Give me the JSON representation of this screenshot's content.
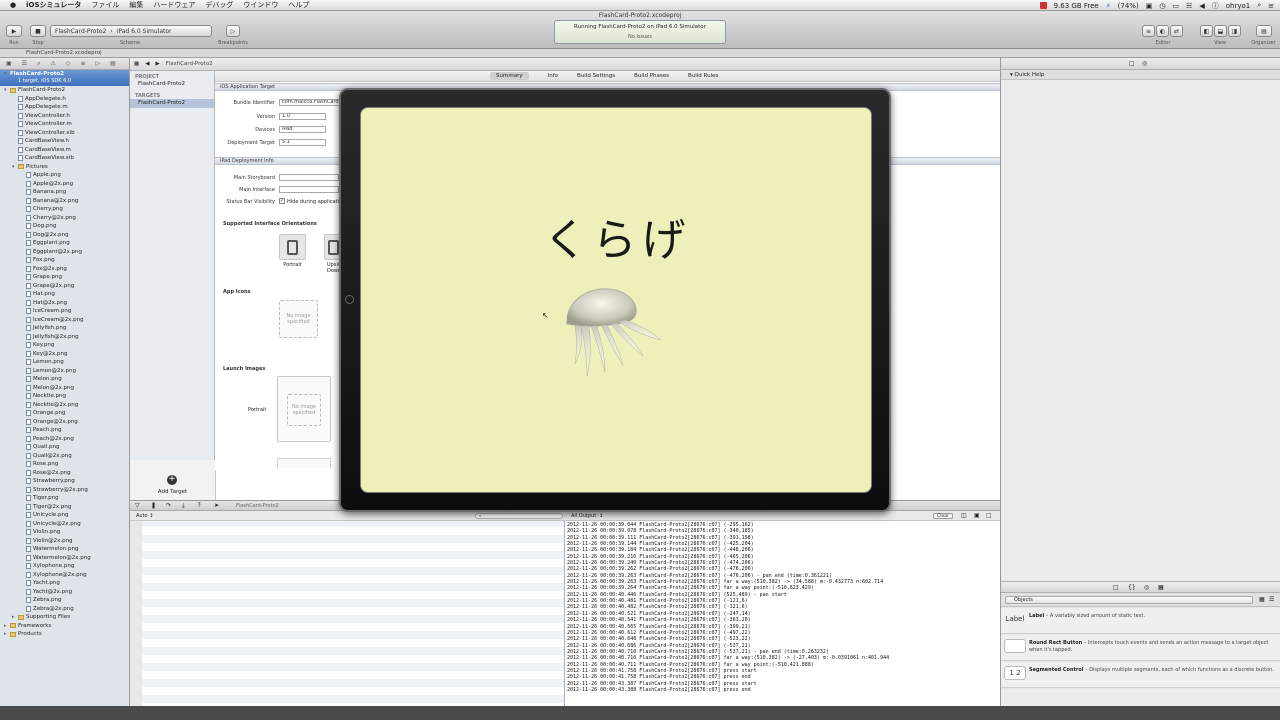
{
  "menubar": {
    "apple": "",
    "items": [
      "iOSシミュレータ",
      "ファイル",
      "編集",
      "ハードウェア",
      "デバッグ",
      "ウインドウ",
      "ヘルプ"
    ],
    "status": {
      "disk": "9.63 GB Free",
      "battery": "(74%)",
      "user": "ohryo1"
    }
  },
  "window": {
    "title": "FlashCard-Proto2.xcodeproj"
  },
  "toolbar": {
    "run_label": "Run",
    "stop_label": "Stop",
    "scheme_label": "Scheme",
    "breakpoints_label": "Breakpoints",
    "scheme": "FlashCard-Proto2",
    "destination": "iPad 6.0 Simulator",
    "activity_title": "Running FlashCard-Proto2 on iPad 6.0 Simulator",
    "activity_sub": "No Issues",
    "editor_label": "Editor",
    "view_label": "View",
    "organizer_label": "Organizer"
  },
  "jumpbar": {
    "left": "FlashCard-Proto2.xcodeproj",
    "crumb": "FlashCard-Proto2"
  },
  "navigator": {
    "project": "FlashCard-Proto2",
    "project_sub": "1 target, iOS SDK 6.0",
    "items": [
      {
        "label": "FlashCard-Proto2",
        "level": 1,
        "kind": "folder"
      },
      {
        "label": "AppDelegate.h",
        "level": 2,
        "kind": "file"
      },
      {
        "label": "AppDelegate.m",
        "level": 2,
        "kind": "file"
      },
      {
        "label": "ViewController.h",
        "level": 2,
        "kind": "file"
      },
      {
        "label": "ViewController.m",
        "level": 2,
        "kind": "file"
      },
      {
        "label": "ViewController.xib",
        "level": 2,
        "kind": "file"
      },
      {
        "label": "CardBaseView.h",
        "level": 2,
        "kind": "file"
      },
      {
        "label": "CardBaseView.m",
        "level": 2,
        "kind": "file"
      },
      {
        "label": "CardBaseView.xib",
        "level": 2,
        "kind": "file"
      },
      {
        "label": "Pictures",
        "level": 2,
        "kind": "folder"
      },
      {
        "label": "Apple.png",
        "level": 3,
        "kind": "file"
      },
      {
        "label": "Apple@2x.png",
        "level": 3,
        "kind": "file"
      },
      {
        "label": "Banana.png",
        "level": 3,
        "kind": "file"
      },
      {
        "label": "Banana@2x.png",
        "level": 3,
        "kind": "file"
      },
      {
        "label": "Cherry.png",
        "level": 3,
        "kind": "file"
      },
      {
        "label": "Cherry@2x.png",
        "level": 3,
        "kind": "file"
      },
      {
        "label": "Dog.png",
        "level": 3,
        "kind": "file"
      },
      {
        "label": "Dog@2x.png",
        "level": 3,
        "kind": "file"
      },
      {
        "label": "Eggplant.png",
        "level": 3,
        "kind": "file"
      },
      {
        "label": "Eggplant@2x.png",
        "level": 3,
        "kind": "file"
      },
      {
        "label": "Fox.png",
        "level": 3,
        "kind": "file"
      },
      {
        "label": "Fox@2x.png",
        "level": 3,
        "kind": "file"
      },
      {
        "label": "Grape.png",
        "level": 3,
        "kind": "file"
      },
      {
        "label": "Grape@2x.png",
        "level": 3,
        "kind": "file"
      },
      {
        "label": "Hat.png",
        "level": 3,
        "kind": "file"
      },
      {
        "label": "Hat@2x.png",
        "level": 3,
        "kind": "file"
      },
      {
        "label": "IceCream.png",
        "level": 3,
        "kind": "file"
      },
      {
        "label": "IceCream@2x.png",
        "level": 3,
        "kind": "file"
      },
      {
        "label": "Jellyfish.png",
        "level": 3,
        "kind": "file"
      },
      {
        "label": "Jellyfish@2x.png",
        "level": 3,
        "kind": "file"
      },
      {
        "label": "Key.png",
        "level": 3,
        "kind": "file"
      },
      {
        "label": "Key@2x.png",
        "level": 3,
        "kind": "file"
      },
      {
        "label": "Lemon.png",
        "level": 3,
        "kind": "file"
      },
      {
        "label": "Lemon@2x.png",
        "level": 3,
        "kind": "file"
      },
      {
        "label": "Melon.png",
        "level": 3,
        "kind": "file"
      },
      {
        "label": "Melon@2x.png",
        "level": 3,
        "kind": "file"
      },
      {
        "label": "Necktie.png",
        "level": 3,
        "kind": "file"
      },
      {
        "label": "Necktie@2x.png",
        "level": 3,
        "kind": "file"
      },
      {
        "label": "Orange.png",
        "level": 3,
        "kind": "file"
      },
      {
        "label": "Orange@2x.png",
        "level": 3,
        "kind": "file"
      },
      {
        "label": "Peach.png",
        "level": 3,
        "kind": "file"
      },
      {
        "label": "Peach@2x.png",
        "level": 3,
        "kind": "file"
      },
      {
        "label": "Quail.png",
        "level": 3,
        "kind": "file"
      },
      {
        "label": "Quail@2x.png",
        "level": 3,
        "kind": "file"
      },
      {
        "label": "Rose.png",
        "level": 3,
        "kind": "file"
      },
      {
        "label": "Rose@2x.png",
        "level": 3,
        "kind": "file"
      },
      {
        "label": "Strawberry.png",
        "level": 3,
        "kind": "file"
      },
      {
        "label": "Strawberry@2x.png",
        "level": 3,
        "kind": "file"
      },
      {
        "label": "Tiger.png",
        "level": 3,
        "kind": "file"
      },
      {
        "label": "Tiger@2x.png",
        "level": 3,
        "kind": "file"
      },
      {
        "label": "Unicycle.png",
        "level": 3,
        "kind": "file"
      },
      {
        "label": "Unicycle@2x.png",
        "level": 3,
        "kind": "file"
      },
      {
        "label": "Violin.png",
        "level": 3,
        "kind": "file"
      },
      {
        "label": "Violin@2x.png",
        "level": 3,
        "kind": "file"
      },
      {
        "label": "Watermelon.png",
        "level": 3,
        "kind": "file"
      },
      {
        "label": "Watermelon@2x.png",
        "level": 3,
        "kind": "file"
      },
      {
        "label": "Xylophone.png",
        "level": 3,
        "kind": "file"
      },
      {
        "label": "Xylophone@2x.png",
        "level": 3,
        "kind": "file"
      },
      {
        "label": "Yacht.png",
        "level": 3,
        "kind": "file"
      },
      {
        "label": "Yacht@2x.png",
        "level": 3,
        "kind": "file"
      },
      {
        "label": "Zebra.png",
        "level": 3,
        "kind": "file"
      },
      {
        "label": "Zebra@2x.png",
        "level": 3,
        "kind": "file"
      },
      {
        "label": "Supporting Files",
        "level": 2,
        "kind": "folder-closed"
      },
      {
        "label": "Frameworks",
        "level": 1,
        "kind": "folder-closed"
      },
      {
        "label": "Products",
        "level": 1,
        "kind": "folder-closed"
      }
    ]
  },
  "editor": {
    "project_header": "PROJECT",
    "project_item": "FlashCard-Proto2",
    "targets_header": "TARGETS",
    "target_item": "FlashCard-Proto2",
    "add_target": "Add Target",
    "tabs": [
      "Summary",
      "Info",
      "Build Settings",
      "Build Phases",
      "Build Rules"
    ],
    "section_ios": "iOS Application Target",
    "bundle_label": "Bundle Identifier",
    "bundle_value": "com.maicca.FlashCard",
    "version_label": "Version",
    "version_value": "1.0",
    "devices_label": "Devices",
    "devices_value": "iPad",
    "deploy_label": "Deployment Target",
    "deploy_value": "5.1",
    "section_ipad": "iPad Deployment Info",
    "storyboard_label": "Main Storyboard",
    "interface_label": "Main Interface",
    "statusbar_label": "Status Bar Visibility",
    "statusbar_check": "Hide during application launch",
    "orientations_header": "Supported Interface Orientations",
    "portrait_label": "Portrait",
    "upside_label": "Upside Down",
    "appicons_header": "App Icons",
    "no_image": "No image specified",
    "launch_header": "Launch Images",
    "launch_portrait": "Portrait"
  },
  "debug": {
    "crumb": "FlashCard-Proto2",
    "vars_scope": "Auto",
    "output_scope": "All Output",
    "clear": "Clear"
  },
  "console_lines": [
    "2012-11-26 00:00:39.044 FlashCard-Proto2[28676:c07] (-295,162)",
    "2012-11-26 00:00:39.078 FlashCard-Proto2[28676:c07] (-340,185)",
    "2012-11-26 00:00:39.111 FlashCard-Proto2[28676:c07] (-391,198)",
    "2012-11-26 00:00:39.144 FlashCard-Proto2[28676:c07] (-425,204)",
    "2012-11-26 00:00:39.184 FlashCard-Proto2[28676:c07] (-448,206)",
    "2012-11-26 00:00:39.216 FlashCard-Proto2[28676:c07] (-465,206)",
    "2012-11-26 00:00:39.240 FlashCard-Proto2[28676:c07] (-474,206)",
    "2012-11-26 00:00:39.262 FlashCard-Proto2[28676:c07] (-476,206)",
    "2012-11-26 00:00:39.263 FlashCard-Proto2[28676:c07] (-476,206) - pan end (time:0.361221)",
    "2012-11-26 00:00:39.263 FlashCard-Proto2[28676:c07] far a way:(510,382) -> (34,588) m:-0.432773 n:602.714",
    "2012-11-26 00:00:39.264 FlashCard-Proto2[28676:c07] far a way point:(-510,823.429)",
    "2012-11-26 00:00:40.446 FlashCard-Proto2[28676:c07] (525,489) - pan start",
    "2012-11-26 00:00:40.481 FlashCard-Proto2[28676:c07] (-121,6)",
    "2012-11-26 00:00:40.482 FlashCard-Proto2[28676:c07] (-121,6)",
    "2012-11-26 00:00:40.521 FlashCard-Proto2[28676:c07] (-247,14)",
    "2012-11-26 00:00:40.541 FlashCard-Proto2[28676:c07] (-363,20)",
    "2012-11-26 00:00:40.565 FlashCard-Proto2[28676:c07] (-399,21)",
    "2012-11-26 00:00:40.612 FlashCard-Proto2[28676:c07] (-497,22)",
    "2012-11-26 00:00:40.648 FlashCard-Proto2[28676:c07] (-523,22)",
    "2012-11-26 00:00:40.686 FlashCard-Proto2[28676:c07] (-537,21)",
    "2012-11-26 00:00:40.710 FlashCard-Proto2[28676:c07] (-537,21) - pan end (time:0.263232)",
    "2012-11-26 00:00:40.710 FlashCard-Proto2[28676:c07] far a way:(510,382) -> (-27,403) m:-0.0391061 n:401.944",
    "2012-11-26 00:00:40.711 FlashCard-Proto2[28676:c07] far a way point:(-510,421.888)",
    "2012-11-26 00:00:41.758 FlashCard-Proto2[28676:c07] press start",
    "2012-11-26 00:00:41.758 FlashCard-Proto2[28676:c07] press end",
    "2012-11-26 00:00:43.387 FlashCard-Proto2[28676:c07] press start",
    "2012-11-26 00:00:43.388 FlashCard-Proto2[28676:c07] press end"
  ],
  "utility": {
    "quick_help": "Quick Help",
    "library_filter": "Objects",
    "library": [
      {
        "icon": "Label",
        "title": "Label",
        "desc": " – A variably sized amount of static text."
      },
      {
        "icon": "",
        "title": "Round Rect Button",
        "desc": " – Intercepts touch events and sends an action message to a target object when it's tapped."
      },
      {
        "icon": "1 2",
        "title": "Segmented Control",
        "desc": " – Displays multiple segments, each of which functions as a discrete button."
      }
    ]
  },
  "simulator": {
    "card_word": "くらげ",
    "bg_color": "#efefbc"
  }
}
